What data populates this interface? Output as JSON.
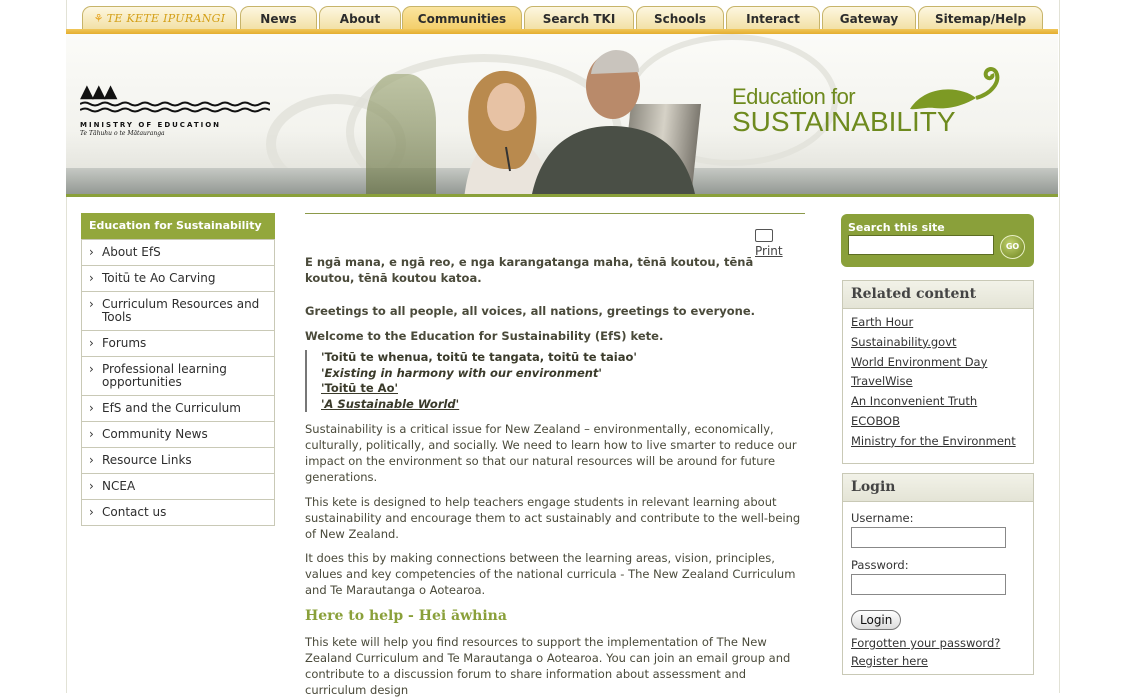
{
  "tabs": {
    "tki": "TE KETE IPURANGI",
    "items": [
      "News",
      "About",
      "Communities",
      "Search TKI",
      "Schools",
      "Interact",
      "Gateway",
      "Sitemap/Help"
    ]
  },
  "banner": {
    "moe_line1": "MINISTRY OF EDUCATION",
    "moe_line2": "Te Tāhuhu o te Mātauranga",
    "efs_line1": "Education for",
    "efs_line2": "SUSTAINABILITY"
  },
  "leftnav": {
    "title": "Education for Sustainability",
    "items": [
      "About EfS",
      "Toitū te Ao Carving",
      "Curriculum Resources and Tools",
      "Forums",
      "Professional learning opportunities",
      "EfS and the Curriculum",
      "Community News",
      "Resource Links",
      "NCEA",
      "Contact us"
    ]
  },
  "main": {
    "print": "Print",
    "greeting_maori": "E ngā mana, e ngā reo, e nga karangatanga maha, tēnā koutou, tēnā koutou, tēnā koutou katoa.",
    "greeting_en": "Greetings to all people, all voices, all nations, greetings to everyone.",
    "welcome": "Welcome to the Education for Sustainability (EfS) kete.",
    "quote": [
      "'Toitū te whenua, toitū te tangata, toitū te taiao'",
      "'Existing in harmony with our environment'",
      "'Toitū te Ao'",
      "'A Sustainable World'"
    ],
    "p1": "Sustainability is a critical issue for New Zealand – environmentally, economically, culturally, politically, and socially. We need to learn how to live smarter to reduce our impact on the environment so that our natural resources will be around for future generations.",
    "p2": "This kete is designed to help teachers engage students in relevant learning about sustainability and encourage them to act sustainably and contribute to the well-being of New Zealand.",
    "p3": "It does this by making connections between the learning areas, vision, principles, values and key competencies of the national curricula - The New Zealand Curriculum and Te Marautanga o Aotearoa.",
    "h2": "Here to help - Hei āwhina",
    "p4": "This kete will help you find resources to support the implementation of The New Zealand Curriculum and Te Marautanga o Aotearoa. You can join an email group and contribute to a discussion forum to share information about assessment and curriculum design"
  },
  "search": {
    "label": "Search this site",
    "go": "GO"
  },
  "related": {
    "title": "Related content",
    "links": [
      "Earth Hour",
      "Sustainability.govt",
      "World Environment Day",
      "TravelWise",
      "An Inconvenient Truth",
      "ECOBOB",
      "Ministry for the Environment"
    ]
  },
  "login": {
    "title": "Login",
    "username": "Username:",
    "password": "Password:",
    "button": "Login",
    "forgot": "Forgotten your password?",
    "register": "Register here"
  },
  "colors": {
    "accent_green": "#8aa03a",
    "tab_gold": "#f2e1a6",
    "tab_active": "#f3cf6b"
  }
}
